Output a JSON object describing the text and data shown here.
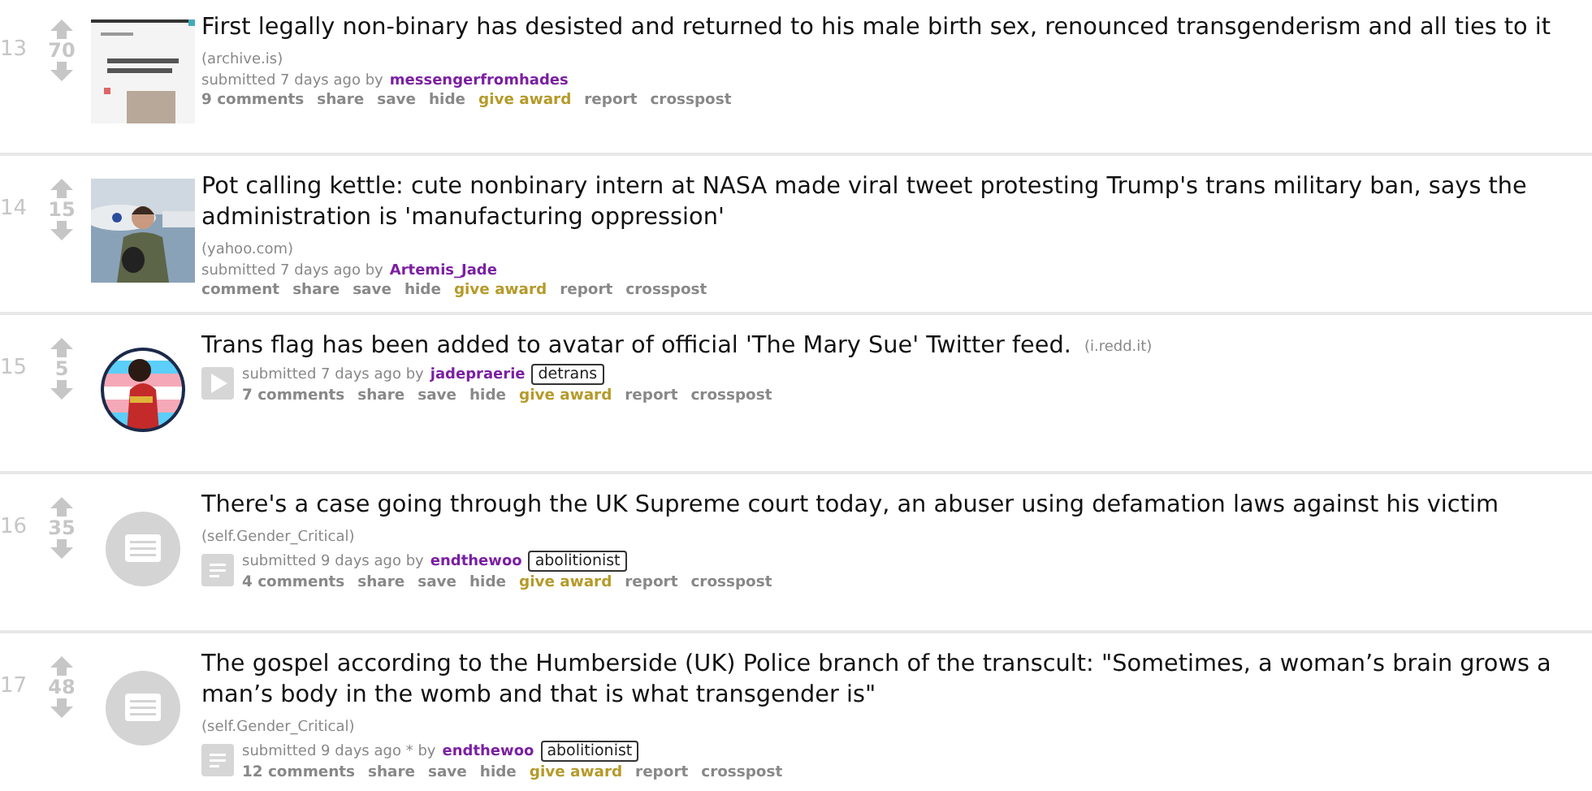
{
  "posts": [
    {
      "rank": "13",
      "score": "70",
      "title": "First legally non-binary has desisted and returned to his male birth sex, renounced transgenderism and all ties to it",
      "domain": "(archive.is)",
      "submitted": "submitted 7 days ago by",
      "author": "messengerfromhades",
      "actions": [
        {
          "label": "9 comments",
          "kind": "link"
        },
        {
          "label": "share",
          "kind": "link"
        },
        {
          "label": "save",
          "kind": "link"
        },
        {
          "label": "hide",
          "kind": "link"
        },
        {
          "label": "give award",
          "kind": "award"
        },
        {
          "label": "report",
          "kind": "link"
        },
        {
          "label": "crosspost",
          "kind": "link"
        }
      ]
    },
    {
      "rank": "14",
      "score": "15",
      "title": "Pot calling kettle: cute nonbinary intern at NASA made viral tweet protesting Trump's trans military ban, says the administration is 'manufacturing oppression'",
      "domain": "(yahoo.com)",
      "submitted": "submitted 7 days ago by",
      "author": "Artemis_Jade",
      "actions": [
        {
          "label": "comment",
          "kind": "link"
        },
        {
          "label": "share",
          "kind": "link"
        },
        {
          "label": "save",
          "kind": "link"
        },
        {
          "label": "hide",
          "kind": "link"
        },
        {
          "label": "give award",
          "kind": "award"
        },
        {
          "label": "report",
          "kind": "link"
        },
        {
          "label": "crosspost",
          "kind": "link"
        }
      ]
    },
    {
      "rank": "15",
      "score": "5",
      "thumbnail": {
        "kind": "avatar"
      },
      "title": "Trans flag has been added to avatar of official 'The Mary Sue' Twitter feed.",
      "domain": "(i.redd.it)",
      "expando": {
        "kind": "video"
      },
      "submitted": "submitted 7 days ago by",
      "author": "jadepraerie",
      "flair": "detrans",
      "actions": [
        {
          "label": "7 comments",
          "kind": "link"
        },
        {
          "label": "share",
          "kind": "link"
        },
        {
          "label": "save",
          "kind": "link"
        },
        {
          "label": "hide",
          "kind": "link"
        },
        {
          "label": "give award",
          "kind": "award"
        },
        {
          "label": "report",
          "kind": "link"
        },
        {
          "label": "crosspost",
          "kind": "link"
        }
      ]
    },
    {
      "rank": "16",
      "score": "35",
      "thumbnail": {
        "kind": "self"
      },
      "title": "There's a case going through the UK Supreme court today, an abuser using defamation laws against his victim",
      "domain": "(self.Gender_Critical)",
      "expando": {
        "kind": "text"
      },
      "submitted": "submitted 9 days ago by",
      "author": "endthewoo",
      "flair": "abolitionist",
      "actions": [
        {
          "label": "4 comments",
          "kind": "link"
        },
        {
          "label": "share",
          "kind": "link"
        },
        {
          "label": "save",
          "kind": "link"
        },
        {
          "label": "hide",
          "kind": "link"
        },
        {
          "label": "give award",
          "kind": "award"
        },
        {
          "label": "report",
          "kind": "link"
        },
        {
          "label": "crosspost",
          "kind": "link"
        }
      ]
    },
    {
      "rank": "17",
      "score": "48",
      "thumbnail": {
        "kind": "self"
      },
      "title": "The gospel according to the Humberside (UK) Police branch of the transcult: \"Sometimes, a woman’s brain grows a man’s body in the womb and that is what transgender is\"",
      "domain": "(self.Gender_Critical)",
      "expando": {
        "kind": "text"
      },
      "submitted": "submitted 9 days ago * by",
      "author": "endthewoo",
      "flair": "abolitionist",
      "actions": [
        {
          "label": "12 comments",
          "kind": "link"
        },
        {
          "label": "share",
          "kind": "link"
        },
        {
          "label": "save",
          "kind": "link"
        },
        {
          "label": "hide",
          "kind": "link"
        },
        {
          "label": "give award",
          "kind": "award"
        },
        {
          "label": "report",
          "kind": "link"
        },
        {
          "label": "crosspost",
          "kind": "link"
        }
      ]
    }
  ]
}
